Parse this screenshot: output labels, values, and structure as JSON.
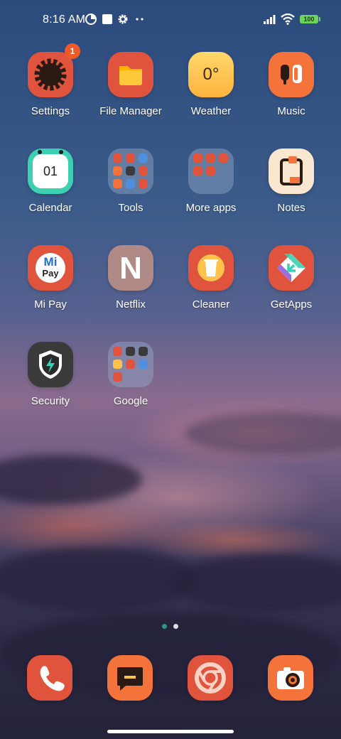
{
  "status_bar": {
    "time": "8:16 AM",
    "battery": "100",
    "icons": [
      "data-saver-icon",
      "square-notification-icon",
      "gear-icon",
      "more-dots-icon",
      "signal-icon",
      "wifi-icon",
      "battery-icon"
    ]
  },
  "apps": [
    {
      "label": "Settings",
      "icon": "settings-icon",
      "badge": "1",
      "color": "#e0543e"
    },
    {
      "label": "File Manager",
      "icon": "folder-icon",
      "color": "#e0543e"
    },
    {
      "label": "Weather",
      "icon": "weather-icon",
      "value": "0°",
      "color": "#ffc24a"
    },
    {
      "label": "Music",
      "icon": "music-icon",
      "color": "#f3733a"
    },
    {
      "label": "Calendar",
      "icon": "calendar-icon",
      "value": "01",
      "color": "#3ccfb2"
    },
    {
      "label": "Tools",
      "icon": "folder-tools-icon"
    },
    {
      "label": "More apps",
      "icon": "folder-more-apps-icon"
    },
    {
      "label": "Notes",
      "icon": "notes-icon",
      "color": "#fbe6cf"
    },
    {
      "label": "Mi Pay",
      "icon": "mi-pay-icon",
      "mark": "Mi",
      "submark": "Pay",
      "color": "#e0543e"
    },
    {
      "label": "Netflix",
      "icon": "netflix-icon",
      "mark": "N",
      "color": "#b08a86"
    },
    {
      "label": "Cleaner",
      "icon": "cleaner-icon",
      "color": "#e0543e"
    },
    {
      "label": "GetApps",
      "icon": "getapps-icon",
      "color": "#e0543e"
    },
    {
      "label": "Security",
      "icon": "security-icon",
      "color": "#3a3a3a"
    },
    {
      "label": "Google",
      "icon": "folder-google-icon"
    }
  ],
  "dock": [
    {
      "icon": "phone-icon",
      "color": "#e0543e"
    },
    {
      "icon": "messages-icon",
      "color": "#f3733a"
    },
    {
      "icon": "chrome-icon",
      "color": "#e0543e"
    },
    {
      "icon": "camera-icon",
      "color": "#f3733a"
    }
  ],
  "page_indicator": {
    "pages": 2,
    "current": 1
  }
}
